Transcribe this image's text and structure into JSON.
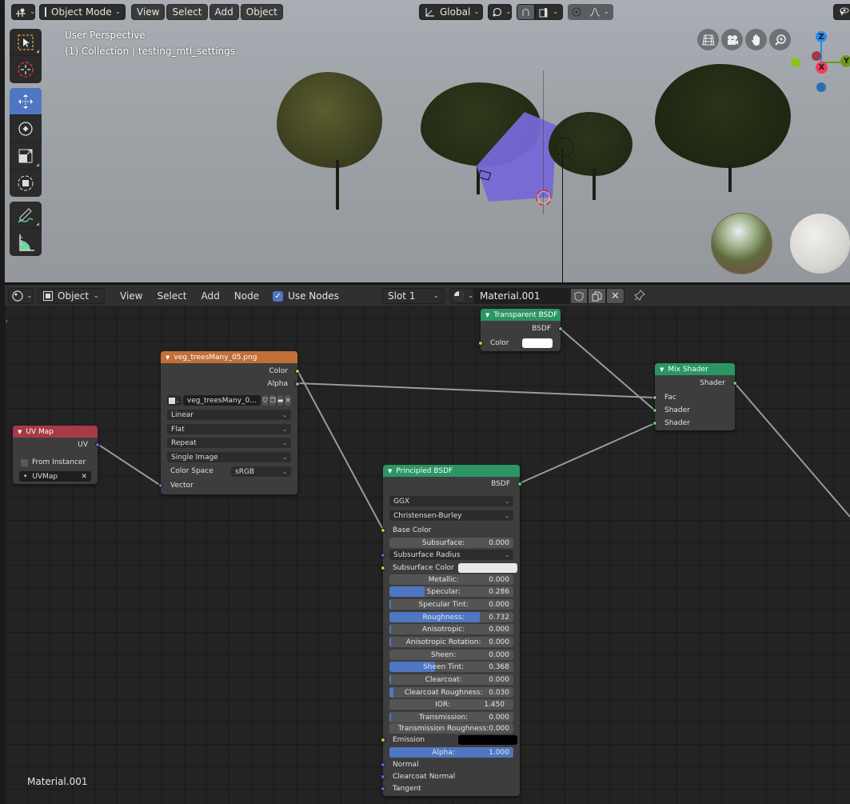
{
  "viewport": {
    "header": {
      "editor_type_icon": "viewport-editor-icon",
      "mode": "Object Mode",
      "menus": [
        "View",
        "Select",
        "Add",
        "Object"
      ],
      "transform_orientation": "Global",
      "pivot_icon": "pivot-point-icon",
      "snap_icon": "snap-magnet-icon",
      "snap_target_icon": "snap-increment-icon",
      "proportional_icon": "proportional-edit-icon",
      "falloff_icon": "falloff-curve-icon",
      "visibility_icon": "selectability-visibility-icon"
    },
    "overlay": {
      "view_name": "User Perspective",
      "collection_info": "(1) Collection | testing_mtl_settings"
    },
    "toolbar": [
      {
        "name": "select-box",
        "icon": "select-box-icon",
        "active": false
      },
      {
        "name": "cursor",
        "icon": "cursor-icon",
        "active": false
      },
      {
        "name": "move",
        "icon": "move-icon",
        "active": true
      },
      {
        "name": "rotate",
        "icon": "rotate-icon",
        "active": false
      },
      {
        "name": "scale",
        "icon": "scale-icon",
        "active": false
      },
      {
        "name": "transform",
        "icon": "transform-icon",
        "active": false
      },
      {
        "name": "annotate",
        "icon": "annotate-icon",
        "active": false
      },
      {
        "name": "measure",
        "icon": "measure-icon",
        "active": false
      }
    ],
    "navigation": [
      "grid-view-icon",
      "camera-view-icon",
      "pan-hand-icon",
      "zoom-icon"
    ],
    "axes": {
      "z": "Z",
      "y": "Y",
      "x": "X"
    },
    "colors": {
      "x": "#f23a55",
      "y": "#8bc21c",
      "z": "#2d8ceb",
      "active_tool": "#4f77c1"
    }
  },
  "node_editor": {
    "header": {
      "editor_type_icon": "shader-editor-icon",
      "object_type": "Object",
      "menus": [
        "View",
        "Select",
        "Add",
        "Node"
      ],
      "use_nodes_label": "Use Nodes",
      "use_nodes_checked": true,
      "slot": "Slot 1",
      "material_name": "Material.001"
    },
    "footer_label": "Material.001",
    "nodes": {
      "uv_map": {
        "title": "UV Map",
        "output": "UV",
        "from_instancer_label": "From Instancer",
        "from_instancer_checked": false,
        "uv_map_value": "UVMap",
        "header_color": "#a73a47"
      },
      "image_texture": {
        "title": "veg_treesMany_05.png",
        "outputs": [
          "Color",
          "Alpha"
        ],
        "image_name": "veg_treesMany_0...",
        "interpolation": "Linear",
        "projection": "Flat",
        "extension": "Repeat",
        "source": "Single Image",
        "color_space_label": "Color Space",
        "color_space": "sRGB",
        "input": "Vector",
        "header_color": "#c26f37"
      },
      "transparent_bsdf": {
        "title": "Transparent BSDF",
        "output": "BSDF",
        "color_label": "Color",
        "color_value": "#ffffff",
        "header_color": "#2b9663"
      },
      "mix_shader": {
        "title": "Mix Shader",
        "output": "Shader",
        "inputs": [
          "Fac",
          "Shader",
          "Shader"
        ],
        "header_color": "#2b9663"
      },
      "principled_bsdf": {
        "title": "Principled BSDF",
        "output": "BSDF",
        "distribution": "GGX",
        "subsurface_method": "Christensen-Burley",
        "base_color_label": "Base Color",
        "subsurface_radius_label": "Subsurface Radius",
        "subsurface_color_label": "Subsurface Color",
        "subsurface_color_value": "#e8e8e8",
        "emission_label": "Emission",
        "emission_value": "#000000",
        "sliders": [
          {
            "label": "Subsurface:",
            "value": "0.000",
            "fraction": 0.0
          },
          {
            "label": "Metallic:",
            "value": "0.000",
            "fraction": 0.0
          },
          {
            "label": "Specular:",
            "value": "0.286",
            "fraction": 0.286
          },
          {
            "label": "Specular Tint:",
            "value": "0.000",
            "fraction": 0.0
          },
          {
            "label": "Roughness:",
            "value": "0.732",
            "fraction": 0.732
          },
          {
            "label": "Anisotropic:",
            "value": "0.000",
            "fraction": 0.0
          },
          {
            "label": "Anisotropic Rotation:",
            "value": "0.000",
            "fraction": 0.0
          },
          {
            "label": "Sheen:",
            "value": "0.000",
            "fraction": 0.0
          },
          {
            "label": "Sheen Tint:",
            "value": "0.368",
            "fraction": 0.368
          },
          {
            "label": "Clearcoat:",
            "value": "0.000",
            "fraction": 0.0
          },
          {
            "label": "Clearcoat Roughness:",
            "value": "0.030",
            "fraction": 0.03
          },
          {
            "label": "IOR:",
            "value": "1.450",
            "fraction": 0.0
          },
          {
            "label": "Transmission:",
            "value": "0.000",
            "fraction": 0.0
          },
          {
            "label": "Transmission Roughness:",
            "value": "0.000",
            "fraction": 0.0
          },
          {
            "label": "Alpha:",
            "value": "1.000",
            "fraction": 1.0
          }
        ],
        "vector_inputs": [
          "Normal",
          "Clearcoat Normal",
          "Tangent"
        ],
        "header_color": "#2b9663"
      }
    }
  }
}
